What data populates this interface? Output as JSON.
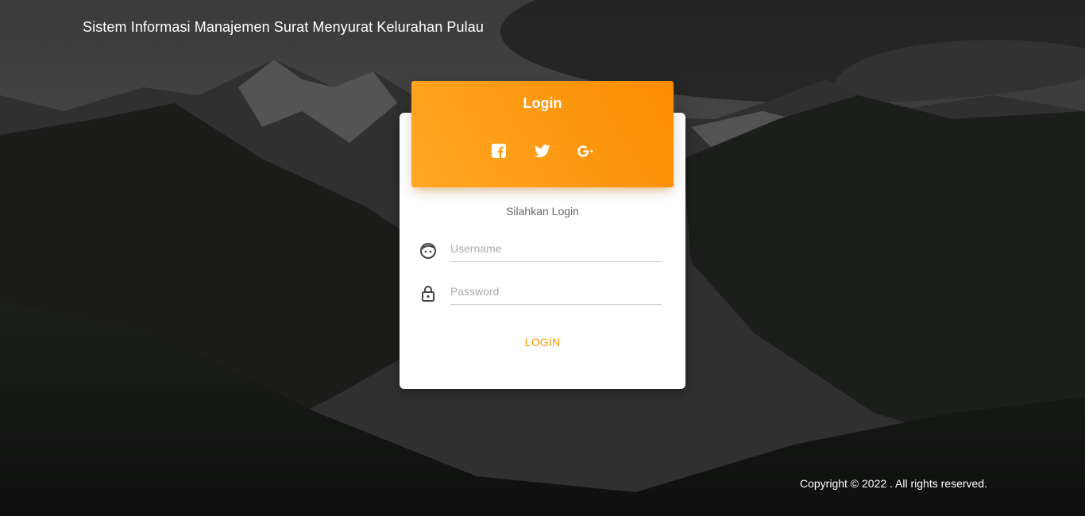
{
  "header": {
    "brand": "Sistem Informasi Manajemen Surat Menyurat Kelurahan Pulau"
  },
  "login_card": {
    "title": "Login",
    "social": [
      {
        "icon": "facebook-icon"
      },
      {
        "icon": "twitter-icon"
      },
      {
        "icon": "google-plus-icon"
      }
    ],
    "subtitle": "Silahkan Login",
    "username": {
      "placeholder": "Username",
      "value": "",
      "icon": "face-icon"
    },
    "password": {
      "placeholder": "Password",
      "value": "",
      "icon": "lock-icon"
    },
    "submit_label": "LOGIN"
  },
  "footer": {
    "copyright": "Copyright © 2022 . All rights reserved."
  },
  "colors": {
    "accent": "#ff9800",
    "header_gradient_start": "#ffa726",
    "header_gradient_end": "#fb8c00"
  }
}
